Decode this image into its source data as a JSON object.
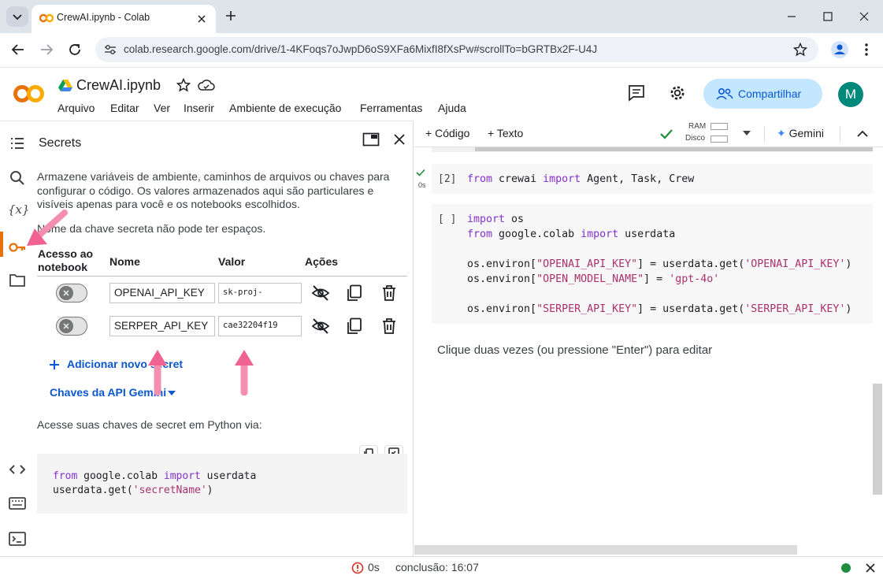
{
  "browser": {
    "tab_title": "CrewAI.ipynb - Colab",
    "url": "colab.research.google.com/drive/1-4KFoqs7oJwpD6oS9XFa6MixfI8fXsPw#scrollTo=bGRTBx2F-U4J"
  },
  "colab": {
    "logo_text": "CO",
    "doc_title": "CrewAI.ipynb",
    "menu": [
      "Arquivo",
      "Editar",
      "Ver",
      "Inserir",
      "Ambiente de execução",
      "Ferramentas",
      "Ajuda"
    ],
    "share_label": "Compartilhar",
    "avatar_initial": "M"
  },
  "secrets": {
    "title": "Secrets",
    "description": "Armazene variáveis de ambiente, caminhos de arquivos ou chaves para configurar o código. Os valores armazenados aqui são particulares e visíveis apenas para você e os notebooks escolhidos.",
    "note": "Nome da chave secreta não pode ter espaços.",
    "headers": {
      "access": "Acesso ao notebook",
      "name": "Nome",
      "value": "Valor",
      "actions": "Ações"
    },
    "rows": [
      {
        "name": "OPENAI_API_KEY",
        "value": "sk-proj-",
        "access_enabled": false
      },
      {
        "name": "SERPER_API_KEY",
        "value": "cae32204f19",
        "access_enabled": false
      }
    ],
    "add_label": "Adicionar novo secret",
    "gemini_keys_label": "Chaves da API Gemini",
    "access_text": "Acesse suas chaves de secret em Python via:",
    "code": {
      "line1_kw1": "from",
      "line1_mod": " google.colab ",
      "line1_kw2": "import",
      "line1_rest": " userdata",
      "line2_pre": "userdata.get(",
      "line2_str": "'secretName'",
      "line2_post": ")"
    }
  },
  "notebook": {
    "toolbar": {
      "code_label": "Código",
      "text_label": "Texto",
      "ram_label": "RAM",
      "disk_label": "Disco",
      "gemini_label": "Gemini"
    },
    "cell1": {
      "exec_count": "[2]",
      "exec_time": "0s",
      "kw1": "from",
      "mid": " crewai ",
      "kw2": "import",
      "rest": " Agent, Task, Crew"
    },
    "cell2": {
      "exec_count": "[ ]",
      "l1_kw": "import",
      "l1_rest": " os",
      "l2_kw1": "from",
      "l2_mid": " google.colab ",
      "l2_kw2": "import",
      "l2_rest": " userdata",
      "l4_pre": "os.environ[",
      "l4_str1": "\"OPENAI_API_KEY\"",
      "l4_mid": "] = userdata.get(",
      "l4_str2": "'OPENAI_API_KEY'",
      "l4_post": ")",
      "l5_pre": "os.environ[",
      "l5_str1": "\"OPEN_MODEL_NAME\"",
      "l5_mid": "] = ",
      "l5_str2": "'gpt-4o'",
      "l7_pre": "os.environ[",
      "l7_str1": "\"SERPER_API_KEY\"",
      "l7_mid": "] = userdata.get(",
      "l7_str2": "'SERPER_API_KEY'",
      "l7_post": ")"
    },
    "text_cell_placeholder": "Clique duas vezes (ou pressione \"Enter\") para editar"
  },
  "status": {
    "elapsed": "0s",
    "completion": "conclusão: 16:07"
  },
  "colors": {
    "accent_blue": "#0b57d0",
    "keyword_purple": "#8430ce",
    "string_red": "#a8326c",
    "colab_orange": "#f9ab00",
    "annotation_pink": "#f06292"
  }
}
